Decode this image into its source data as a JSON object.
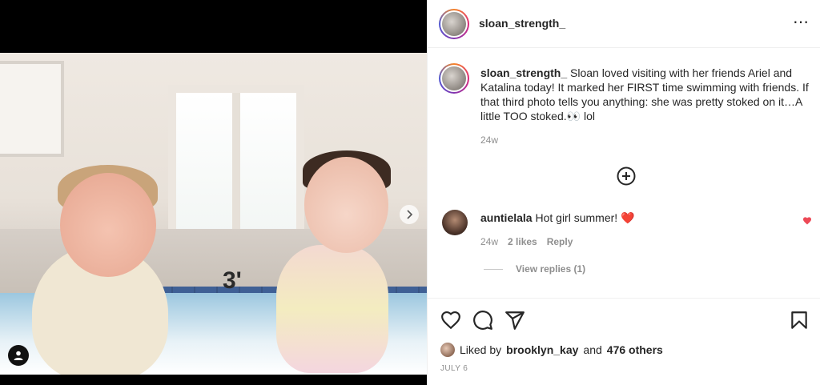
{
  "post": {
    "username": "sloan_strength_",
    "caption_username": "sloan_strength_",
    "caption_text": "Sloan loved visiting with her friends Ariel and Katalina today! It marked her FIRST time swimming with friends. If that third photo tells you anything: she was pretty stoked on it…A little TOO stoked.👀 lol",
    "caption_time": "24w",
    "more_icon": "⋯"
  },
  "comment": {
    "username": "auntielala",
    "text": "Hot girl summer! ❤️",
    "time": "24w",
    "likes": "2 likes",
    "reply_label": "Reply",
    "view_replies": "View replies (1)"
  },
  "likes": {
    "prefix": "Liked by",
    "liker": "brooklyn_kay",
    "and": "and",
    "others": "476 others"
  },
  "date": "JULY 6",
  "media": {
    "pool_depth_label": "3'",
    "icons": [
      "chevron-right-icon",
      "user-tag-icon"
    ]
  },
  "colors": {
    "accent_heart": "#ed4956",
    "text": "#262626",
    "muted": "#8e8e8e"
  }
}
